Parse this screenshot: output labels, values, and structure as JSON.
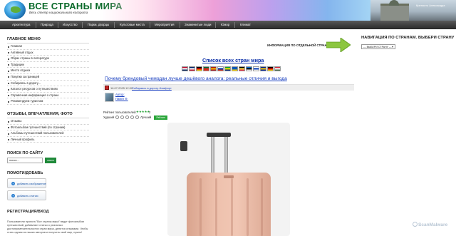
{
  "header": {
    "title": "ВСЕ СТРАНЫ МИРА",
    "tagline": "Весь спектр национального колорита",
    "photo_caption": "Крепость Александра"
  },
  "nav": {
    "items": [
      "Архитектура",
      "Природа",
      "Искусство",
      "Парки, дворцы",
      "Культовые места",
      "Мероприятия",
      "Знаменитые люди",
      "Юмор",
      "Климат"
    ]
  },
  "left_sidebar": {
    "main_menu_heading": "ГЛАВНОЕ МЕНЮ",
    "main_menu": [
      "Главная",
      "Активный отдых",
      "Образ страны в литературе",
      "Традиции",
      "Место отдыха",
      "Покупки за границей",
      "Собираясь в дорогу...",
      "Каталог ресурсов о путешествиях",
      "Справочная информация о стране",
      "Рекомендуем туристам"
    ],
    "reviews_heading": "ОТЗЫВЫ, ВПЕЧАТЛЕНИЯ, ФОТО",
    "reviews_menu": [
      "Отзывы",
      "Фотоальбом путешествий (по странам)",
      "Альбомы путешествий пользователей",
      "Личный профиль"
    ],
    "search_heading": "ПОИСК ПО САЙТУ",
    "search_value": "поиск...",
    "search_button": "поиск",
    "help_heading": "ПОМОГИ/ДОБАВЬ",
    "add_photo": "добавить изображение",
    "add_article": "добавить статью",
    "reg_heading": "РЕГИСТРАЦИЯ/ВХОД",
    "reg_text": "Пользователи проекта \"Все страны мира\" ведут фотоальбом путешествий, добавляют статьи о реальных достопримечательностях стран мира, делятся отзывами. Чтобы стать одним из наших авторов и получить свой мир, нужно!"
  },
  "main": {
    "info_label": "ИНФОРМАЦИЯ ПО ОТДЕЛЬНОЙ СТРАНЕ",
    "countries_link": "Список всех стран мира",
    "article_title": "Почему брендовый чемодан лучше дешёвого аналога: реальные отличия и выгода",
    "meta_date": "16.07.2025 12:02",
    "meta_category": "Собираясь в дорогу...",
    "meta_subcategory": "Комфорт",
    "author_label": "Автор:",
    "author_name": "Павел Ф.",
    "rating_label": "Рейтинг пользователей:",
    "stars": "★★★★★",
    "rating_count": "2",
    "rating_value": 5,
    "worst_label": "Худший",
    "best_label": "Лучший",
    "rate_button": "Рейтинг"
  },
  "right_sidebar": {
    "title": "НАВИГАЦИЯ ПО СТРАНАМ. ВЫБЕРИ СТРАНУ",
    "select_value": "--- ВЫБЕРИ СТРАНУ ---",
    "watermark": "ScanMalware"
  },
  "flags": [
    {
      "name": "flag-norway",
      "colors": [
        "#ba0c2f",
        "#ffffff",
        "#00205b"
      ]
    },
    {
      "name": "flag-uk",
      "colors": [
        "#012169",
        "#ffffff",
        "#c8102e"
      ]
    },
    {
      "name": "flag-germany",
      "colors": [
        "#000000",
        "#dd0000",
        "#ffce00"
      ]
    },
    {
      "name": "flag-portugal",
      "colors": [
        "#046a38",
        "#da291c",
        "#da291c"
      ]
    },
    {
      "name": "flag-spain",
      "colors": [
        "#aa151b",
        "#f1bf00",
        "#aa151b"
      ]
    },
    {
      "name": "flag-russia",
      "colors": [
        "#ffffff",
        "#0039a6",
        "#d52b1e"
      ]
    },
    {
      "name": "flag-brazil",
      "colors": [
        "#009c3b",
        "#ffdf00",
        "#002776"
      ]
    },
    {
      "name": "flag-ukraine",
      "colors": [
        "#0057b7",
        "#0057b7",
        "#ffd700"
      ]
    },
    {
      "name": "flag-belgium",
      "colors": [
        "#000000",
        "#fae042",
        "#ed2939"
      ]
    },
    {
      "name": "flag-estonia",
      "colors": [
        "#0072ce",
        "#000000",
        "#ffffff"
      ]
    },
    {
      "name": "flag-israel",
      "colors": [
        "#ffffff",
        "#0038b8",
        "#ffffff"
      ]
    },
    {
      "name": "flag-bosnia",
      "colors": [
        "#002395",
        "#fecb00",
        "#002395"
      ]
    },
    {
      "name": "flag-germany-2",
      "colors": [
        "#000000",
        "#dd0000",
        "#ffce00"
      ]
    },
    {
      "name": "flag-hungary",
      "colors": [
        "#ce2939",
        "#ffffff",
        "#477050"
      ]
    }
  ],
  "colors": {
    "brand_green": "#0a6a2a",
    "link_blue": "#1a40c0",
    "action_green": "#2aa63a",
    "nav_dark": "#3d3d3d"
  }
}
